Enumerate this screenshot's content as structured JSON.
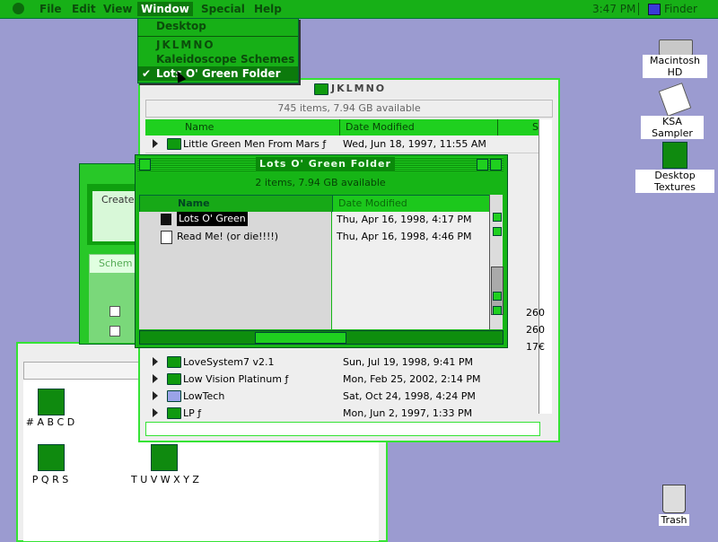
{
  "menubar": {
    "items": [
      "File",
      "Edit",
      "View",
      "Window",
      "Special",
      "Help"
    ],
    "time": "3:47 PM",
    "app": "Finder"
  },
  "window_menu": {
    "items": [
      "Desktop",
      "JKLMNO",
      "Kaleidoscope Schemes",
      "Lots O' Green Folder"
    ],
    "checked": "Lots O' Green Folder"
  },
  "desktop": {
    "icons": [
      "Macintosh HD",
      "KSA Sampler",
      "Desktop Textures",
      "Trash"
    ]
  },
  "jklmno": {
    "title": "JKLMNO",
    "status": "745 items, 7.94 GB available",
    "col_name": "Name",
    "col_date": "Date Modified",
    "col_size": "S",
    "rows": [
      {
        "name": "Little Green Men From Mars ƒ",
        "date": "Wed, Jun 18, 1997, 11:55 AM"
      },
      {
        "name": "LoveSystem7 v2.1",
        "date": "Sun, Jul 19, 1998, 9:41 PM"
      },
      {
        "name": "Low Vision Platinum ƒ",
        "date": "Mon, Feb 25, 2002, 2:14 PM"
      },
      {
        "name": "LowTech",
        "date": "Sat, Oct 24, 1998, 4:24 PM"
      },
      {
        "name": "LP ƒ",
        "date": "Mon, Jun 2, 1997, 1:33 PM"
      }
    ],
    "partial_sizes": [
      "260",
      "260",
      "17€"
    ]
  },
  "lots": {
    "title": "Lots O' Green Folder",
    "status": "2 items, 7.94 GB available",
    "col_name": "Name",
    "col_date": "Date Modified",
    "rows": [
      {
        "name": "Lots O' Green",
        "date": "Thu, Apr 16, 1998, 4:17 PM"
      },
      {
        "name": "Read Me! (or die!!!!)",
        "date": "Thu, Apr 16, 1998, 4:46 PM"
      }
    ]
  },
  "behind_window": {
    "label_created": "Created",
    "tab_label": "Schem"
  },
  "bottom_window": {
    "icons": [
      "# A B C D",
      "P Q R S",
      "T U V W X Y Z"
    ]
  },
  "colors": {
    "accent": "#17b017",
    "desktop": "#9b9bd0"
  }
}
